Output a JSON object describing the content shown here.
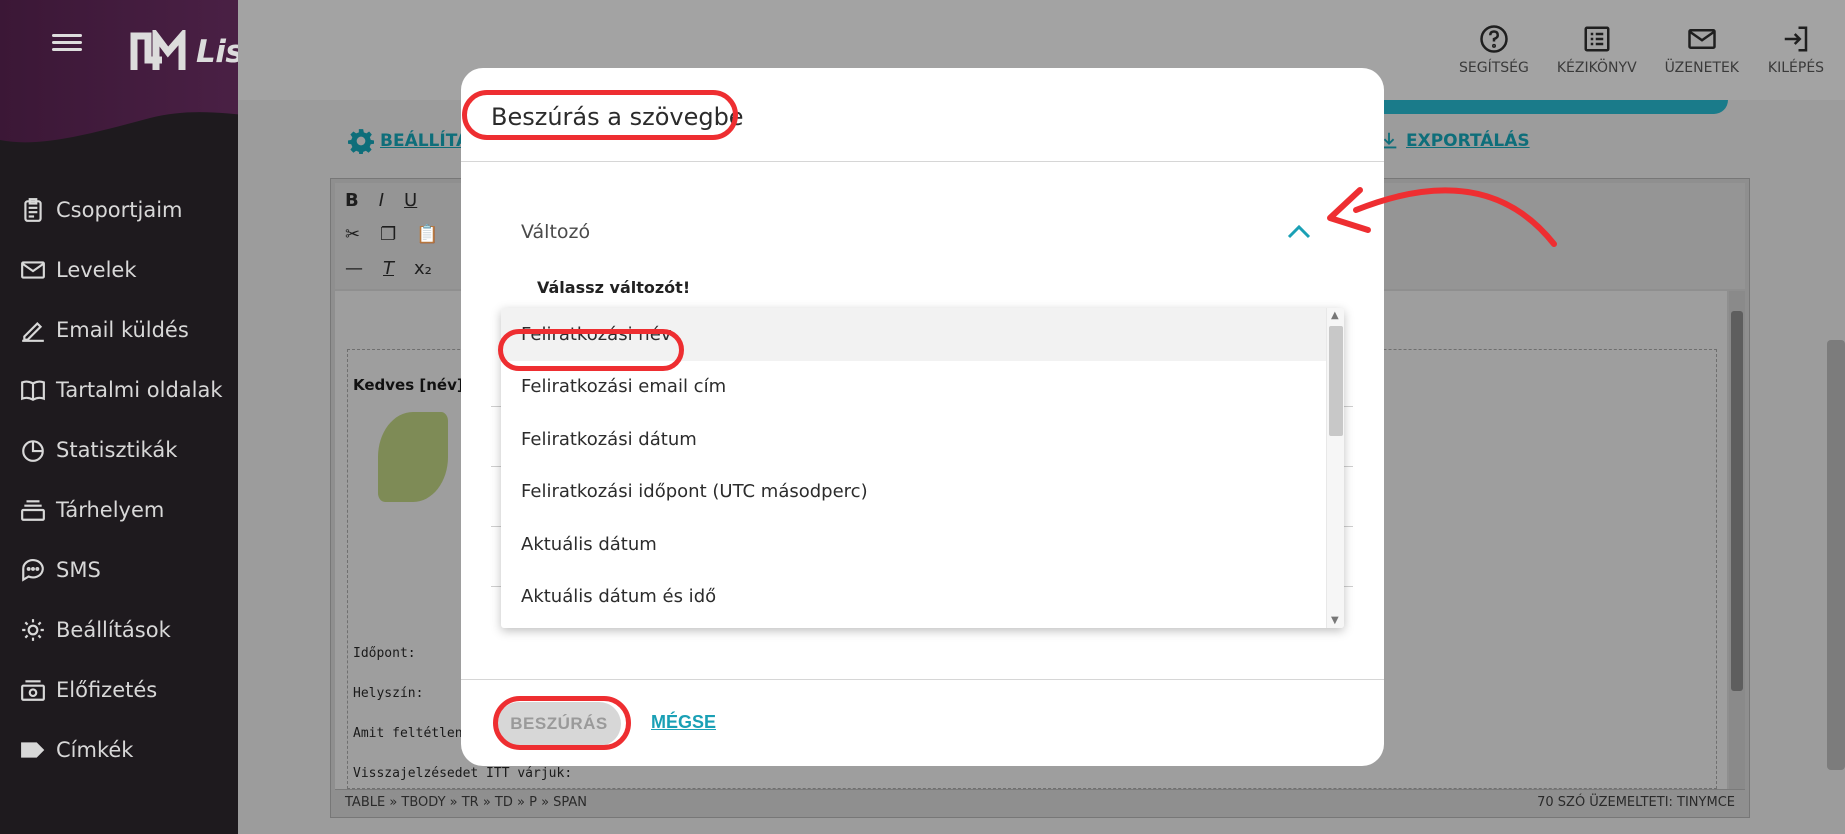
{
  "app": {
    "brand": "ListaMester"
  },
  "sidebar": {
    "items": [
      {
        "label": "Csoportjaim",
        "icon": "clipboard-icon"
      },
      {
        "label": "Levelek",
        "icon": "mail-icon"
      },
      {
        "label": "Email küldés",
        "icon": "pen-icon"
      },
      {
        "label": "Tartalmi oldalak",
        "icon": "book-icon"
      },
      {
        "label": "Statisztikák",
        "icon": "pie-chart-icon"
      },
      {
        "label": "Tárhelyem",
        "icon": "storage-icon"
      },
      {
        "label": "SMS",
        "icon": "chat-icon"
      },
      {
        "label": "Beállítások",
        "icon": "gear-icon"
      },
      {
        "label": "Előfizetés",
        "icon": "money-icon"
      },
      {
        "label": "Címkék",
        "icon": "tag-icon"
      }
    ]
  },
  "topbar": {
    "actions": [
      {
        "label": "SEGÍTSÉG",
        "icon": "help-icon"
      },
      {
        "label": "KÉZIKÖNYV",
        "icon": "manual-icon"
      },
      {
        "label": "ÜZENETEK",
        "icon": "envelope-icon"
      },
      {
        "label": "KILÉPÉS",
        "icon": "logout-icon"
      }
    ]
  },
  "main": {
    "settings_link": "BEÁLLÍTÁS",
    "export_link": "EXPORTÁLÁS",
    "editor": {
      "toolbar_row1": [
        "B",
        "I",
        "U"
      ],
      "greeting": "Kedves [név]!",
      "lines": [
        "Időpont:",
        "Helyszín:",
        "Amit feltétlen ho",
        "Visszajelzésedet ITT várjuk:"
      ],
      "status_path": "TABLE » TBODY » TR » TD » P » SPAN",
      "status_right": "70 SZÓ ÜZEMELTETI: TINYMCE"
    }
  },
  "modal": {
    "title": "Beszúrás a szövegbe",
    "accordion_label": "Változó",
    "select_label": "Válassz változót!",
    "options": [
      "Feliratkozási név",
      "Feliratkozási email cím",
      "Feliratkozási dátum",
      "Feliratkozási időpont (UTC másodperc)",
      "Aktuális dátum",
      "Aktuális dátum és idő"
    ],
    "insert_button": "BESZÚRÁS",
    "cancel_button": "MÉGSE"
  },
  "colors": {
    "accent": "#1aa0b5",
    "annotation_red": "#ee2e31",
    "sidebar_bg": "#1e1a1e",
    "brand_purple": "#4a1f44"
  }
}
